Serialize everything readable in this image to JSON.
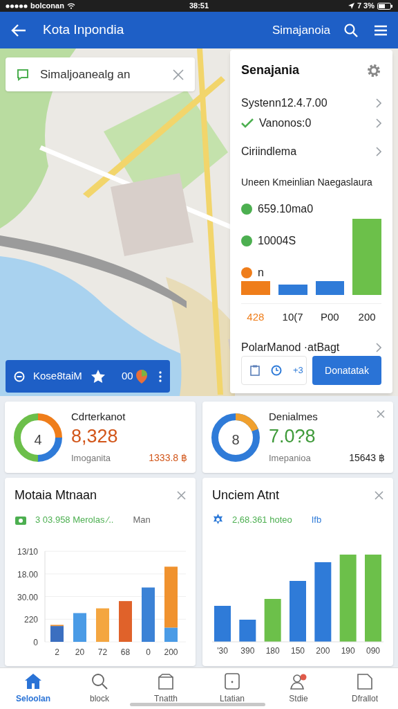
{
  "status_bar": {
    "carrier": "bolconan",
    "time": "38:51",
    "battery": "7 3%"
  },
  "app_bar": {
    "title": "Kota Inpondia",
    "action": "Simajanoia"
  },
  "map": {
    "kind": "picture",
    "search": {
      "value": "Simaljoanealg an"
    },
    "bottom_bar": {
      "label": "Kose8taiM",
      "count": "00"
    }
  },
  "side_panel": {
    "title": "Senajania",
    "rows": [
      {
        "kind": "link",
        "label": "Systenn12.4.7.00"
      },
      {
        "kind": "check",
        "label": "Vanonos:0",
        "checked": true
      },
      {
        "kind": "link",
        "label": "Ciriindlema"
      }
    ],
    "section_title": "Uneen Kmeinlian  Naegaslaura",
    "stats": [
      {
        "value": "659.10ma0",
        "color": "#4caf50"
      },
      {
        "value": "10004S",
        "color": "#4caf50"
      },
      {
        "value": "n",
        "color": "#ef7d1a"
      }
    ],
    "bar_labels": [
      {
        "label": "428",
        "color": "#ef7d1a"
      },
      {
        "label": "10(7",
        "color": "#222222"
      },
      {
        "label": "P00",
        "color": "#222222"
      },
      {
        "label": "200",
        "color": "#222222"
      }
    ],
    "footer_link": "PolarManod ·atBagt",
    "footer_count": "+3",
    "button": "Donatatak"
  },
  "stat_cards": [
    {
      "title": "Cdrterkanot",
      "center": "4",
      "value": "8,328",
      "color": "#d2561a",
      "subtitle": "Imoganita",
      "amount": "1333.8 ฿",
      "closable": false
    },
    {
      "title": "Denialmes",
      "center": "8",
      "value": "7.0?8",
      "color": "#3f9a3a",
      "subtitle": "Imepanioa",
      "amount": "15643 ฿",
      "closable": true
    }
  ],
  "chart_cards": [
    {
      "kind": "chart",
      "title": "Motaia Mtnaan",
      "subtitle": "3 03.958 Merolas ⁄..",
      "extra": "Man",
      "y_labels": [
        "13/10",
        "18.00",
        "30.00",
        "220",
        "0"
      ],
      "x_labels": [
        "2",
        "20",
        "72",
        "68",
        "0",
        "200"
      ]
    },
    {
      "kind": "bars",
      "title": "Unciem Atnt",
      "subtitle": "2,68.361 hoteo",
      "extra": "Ifb",
      "x_labels": [
        "'30",
        "390",
        "180",
        "150",
        "200",
        "190",
        "090"
      ]
    }
  ],
  "nav": [
    {
      "label": "Seloolan",
      "selected": true
    },
    {
      "label": "block",
      "selected": false
    },
    {
      "label": "Tnatth",
      "selected": false
    },
    {
      "label": "Ltatian",
      "selected": false
    },
    {
      "label": "Stdie",
      "selected": false
    },
    {
      "label": "Dfrallot",
      "selected": false
    }
  ]
}
